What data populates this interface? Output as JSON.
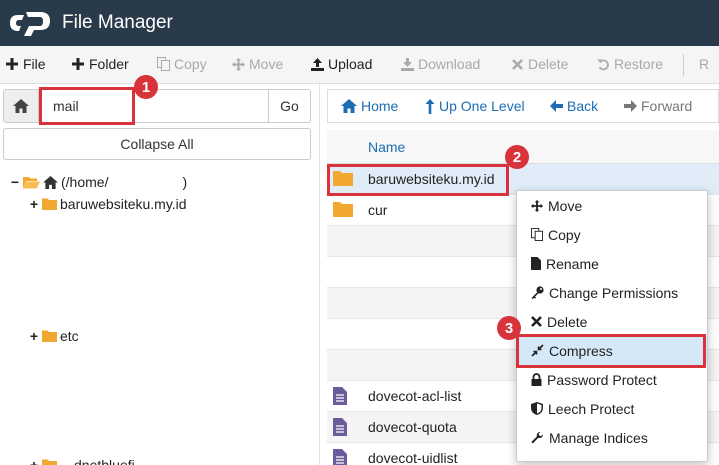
{
  "header": {
    "title": "File Manager"
  },
  "toolbar": {
    "file": "File",
    "folder": "Folder",
    "copy": "Copy",
    "move": "Move",
    "upload": "Upload",
    "download": "Download",
    "delete": "Delete",
    "restore": "Restore",
    "rename_partial": "R"
  },
  "left": {
    "path_value": "mail",
    "go": "Go",
    "collapse_all": "Collapse All",
    "tree": {
      "root_label": "(/home/",
      "root_close": ")",
      "item1": "baruwebsiteku.my.id",
      "item2": "etc",
      "item3": "…dnetbluefi"
    }
  },
  "nav": {
    "home": "Home",
    "up": "Up One Level",
    "back": "Back",
    "forward": "Forward"
  },
  "list": {
    "name_header": "Name",
    "rows": [
      "baruwebsiteku.my.id",
      "cur",
      "dovecot-acl-list",
      "dovecot-quota",
      "dovecot-uidlist"
    ]
  },
  "context_menu": {
    "items": [
      "Move",
      "Copy",
      "Rename",
      "Change Permissions",
      "Delete",
      "Compress",
      "Password Protect",
      "Leech Protect",
      "Manage Indices"
    ]
  },
  "annotations": [
    "1",
    "2",
    "3"
  ],
  "colors": {
    "header_bg": "#293a4a",
    "link_blue": "#1c6db3",
    "folder": "#f0a830",
    "highlight_red": "#d8323b",
    "menu_highlight": "#d5e8f7",
    "selected_row": "#e0edf8",
    "file_icon": "#6b5b9a"
  }
}
